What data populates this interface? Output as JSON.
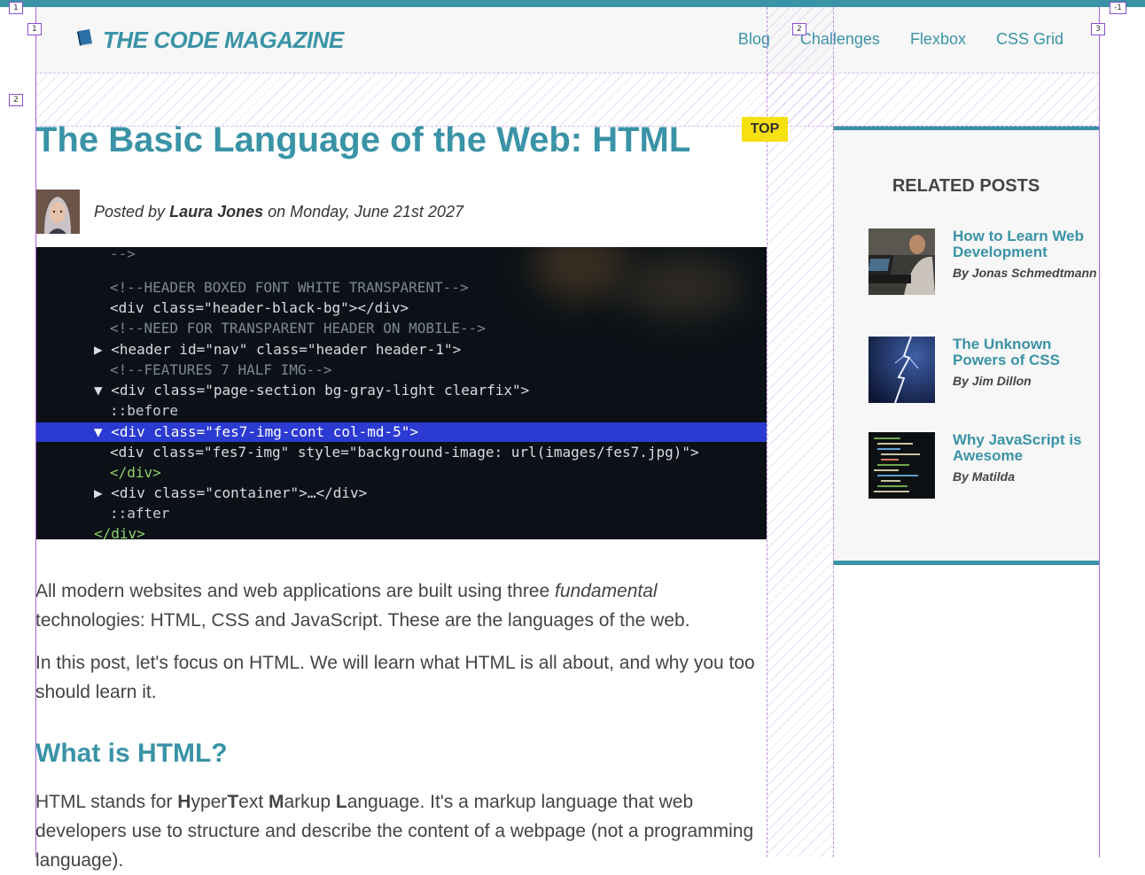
{
  "header": {
    "logo_text": "THE CODE MAGAZINE",
    "nav": [
      "Blog",
      "Challenges",
      "Flexbox",
      "CSS Grid"
    ]
  },
  "badge": "TOP",
  "post": {
    "title": "The Basic Language of the Web: HTML",
    "byline_prefix": "Posted by",
    "author": "Laura Jones",
    "date": "on Monday, June 21st 2027",
    "p1_before": "All modern websites and web applications are built using three",
    "p1_em": "fundamental",
    "p1_after": "technologies: HTML, CSS and JavaScript. These are the languages of the web.",
    "p2": "In this post, let's focus on HTML. We will learn what HTML is all about, and why you too should learn it.",
    "h2": "What is HTML?",
    "p3_a": "HTML stands for",
    "p3_b": "H",
    "p3_c": "yper",
    "p3_d": "T",
    "p3_e": "ext",
    "p3_f": "M",
    "p3_g": "arkup",
    "p3_h": "L",
    "p3_i": "anguage. It's a markup language that web developers use to structure and describe the content of a webpage (not a programming language)."
  },
  "hero_code": [
    "  <!--HEADER BOXED FONT WHITE TRANSPARENT-->",
    "  <div class=\"header-black-bg\"></div>",
    "  <!--NEED FOR TRANSPARENT HEADER ON MOBILE-->",
    "▶ <header id=\"nav\" class=\"header header-1\">",
    "  <!--FEATURES 7 HALF IMG-->",
    "▼ <div class=\"page-section bg-gray-light clearfix\">",
    "    ::before",
    "  ▼ <div class=\"fes7-img-cont col-md-5\">",
    "      <div class=\"fes7-img\" style=\"background-image: url(images/fes7.jpg)\">",
    "    </div>",
    "  ▶ <div class=\"container\">…</div>",
    "    ::after",
    "  </div>"
  ],
  "sidebar": {
    "title": "RELATED POSTS",
    "posts": [
      {
        "title": "How to Learn Web Development",
        "author": "By Jonas Schmedtmann"
      },
      {
        "title": "The Unknown Powers of CSS",
        "author": "By Jim Dillon"
      },
      {
        "title": "Why JavaScript is Awesome",
        "author": "By Matilda"
      }
    ]
  },
  "markers": [
    "1",
    "1",
    "2",
    "2",
    "3",
    "-1"
  ],
  "colors": {
    "accent": "#3a93a6",
    "badge": "#f6e010",
    "grid": "#a866d8"
  }
}
